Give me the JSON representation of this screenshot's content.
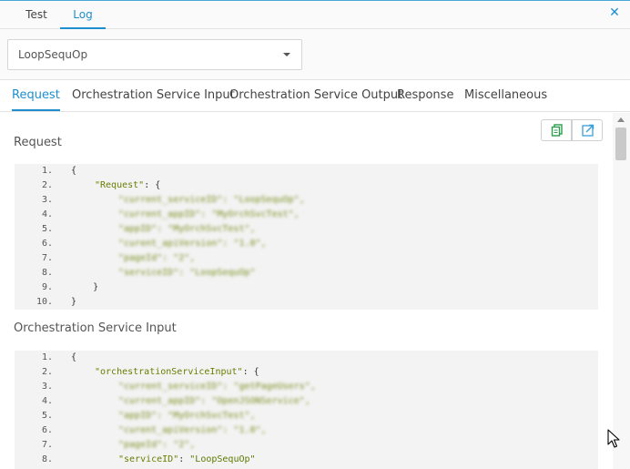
{
  "top_tabs": [
    {
      "label": "Test"
    },
    {
      "label": "Log"
    }
  ],
  "selector": {
    "value": "LoopSequOp"
  },
  "sub_tabs": [
    {
      "label": "Request"
    },
    {
      "label": "Orchestration Service Input"
    },
    {
      "label": "Orchestration Service Output"
    },
    {
      "label": "Response"
    },
    {
      "label": "Miscellaneous"
    }
  ],
  "icons": {
    "close": "close-icon",
    "copy": "copy-icon",
    "popout": "popout-icon"
  },
  "request_section": {
    "title": "Request",
    "lines": [
      {
        "n": "1.",
        "open": "{"
      },
      {
        "n": "2.",
        "key": "\"Request\"",
        "rest": ": {"
      },
      {
        "n": "3.",
        "blurred": "\"current_serviceID\": \"LoopSequOp\","
      },
      {
        "n": "4.",
        "blurred": "\"current_appID\": \"MyOrchSvcTest\","
      },
      {
        "n": "5.",
        "blurred": "\"appID\": \"MyOrchSvcTest\","
      },
      {
        "n": "6.",
        "blurred": "\"curent_apiVersion\": \"1.0\","
      },
      {
        "n": "7.",
        "blurred": "\"pageId\": \"2\","
      },
      {
        "n": "8.",
        "blurred": "\"serviceID\": \"LoopSequOp\""
      },
      {
        "n": "9.",
        "open": "    }"
      },
      {
        "n": "10.",
        "open": "}"
      }
    ]
  },
  "input_section": {
    "title": "Orchestration Service Input",
    "lines": [
      {
        "n": "1.",
        "open": "{"
      },
      {
        "n": "2.",
        "key": "\"orchestrationServiceInput\"",
        "rest": ": {"
      },
      {
        "n": "3.",
        "blurred": "\"current_serviceID\": \"getPageUsers\","
      },
      {
        "n": "4.",
        "blurred": "\"current_appID\": \"OpenJSONService\","
      },
      {
        "n": "5.",
        "blurred": "\"appID\": \"MyOrchSvcTest\","
      },
      {
        "n": "6.",
        "blurred": "\"curent_apiVersion\": \"1.0\","
      },
      {
        "n": "7.",
        "blurred": "\"pageId\": \"2\","
      },
      {
        "n": "8.",
        "key": "\"serviceID\"",
        "rest": ": ",
        "value": "\"LoopSequOp\""
      }
    ]
  }
}
